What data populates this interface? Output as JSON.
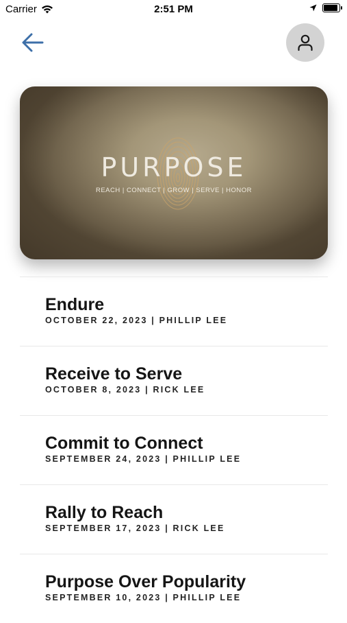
{
  "status_bar": {
    "carrier": "Carrier",
    "time": "2:51 PM"
  },
  "nav": {
    "back_icon": "arrow-left-icon",
    "profile_icon": "person-icon",
    "accent_color": "#3d6fa8"
  },
  "hero": {
    "title": "PURPOSE",
    "subtitle": "REACH | CONNECT | GROW | SERVE | HONOR"
  },
  "sermons": [
    {
      "title": "Endure",
      "meta": "OCTOBER 22, 2023 | PHILLIP LEE"
    },
    {
      "title": "Receive to Serve",
      "meta": "OCTOBER 8, 2023 | RICK LEE"
    },
    {
      "title": "Commit to Connect",
      "meta": "SEPTEMBER 24, 2023 | PHILLIP LEE"
    },
    {
      "title": "Rally to Reach",
      "meta": "SEPTEMBER 17, 2023 | RICK LEE"
    },
    {
      "title": "Purpose Over Popularity",
      "meta": "SEPTEMBER 10, 2023 | PHILLIP LEE"
    }
  ]
}
